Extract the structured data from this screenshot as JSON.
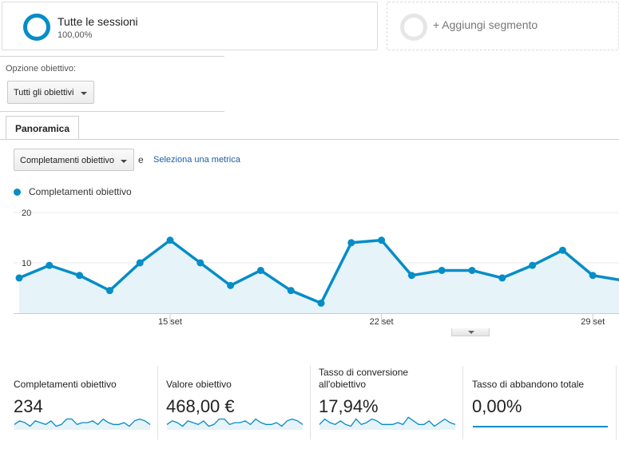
{
  "segments": {
    "active": {
      "title": "Tutte le sessioni",
      "subtitle": "100,00%"
    },
    "add_label": "+ Aggiungi segmento"
  },
  "goal_option": {
    "label": "Opzione obiettivo:",
    "selected": "Tutti gli obiettivi"
  },
  "tabs": [
    {
      "label": "Panoramica",
      "active": true
    }
  ],
  "metric_picker": {
    "selected": "Completamenti obiettivo",
    "conjunction": "e",
    "second_metric_link": "Seleziona una metrica"
  },
  "legend": {
    "series_name": "Completamenti obiettivo",
    "color": "#058dc7"
  },
  "chart_data": {
    "type": "area",
    "series": [
      {
        "name": "Completamenti obiettivo",
        "values": [
          7,
          9.5,
          7.5,
          4.5,
          10,
          14.5,
          10,
          5.5,
          8.5,
          4.5,
          2,
          14,
          14.5,
          7.5,
          8.5,
          8.5,
          7,
          9.5,
          12.5,
          7.5,
          6.5
        ]
      }
    ],
    "y_ticks": [
      "20",
      "10"
    ],
    "ylim": [
      0,
      20
    ],
    "x_tick_labels": [
      "15 set",
      "22 set",
      "29 set"
    ],
    "x_tick_index": [
      5,
      12,
      19
    ],
    "grid": true,
    "color": "#058dc7",
    "fill": "#e6f3f9"
  },
  "metrics": [
    {
      "label": "Completamenti obiettivo",
      "value": "234",
      "spark": [
        3,
        5,
        4,
        2,
        5,
        4,
        3,
        5,
        2,
        3,
        6,
        6,
        3,
        4,
        4,
        5,
        3,
        6,
        4,
        3,
        3,
        4,
        2,
        5,
        6,
        5,
        3
      ]
    },
    {
      "label": "Valore obiettivo",
      "value": "468,00 €",
      "spark": [
        3,
        5,
        4,
        2,
        5,
        4,
        3,
        5,
        2,
        3,
        6,
        6,
        3,
        4,
        4,
        5,
        3,
        6,
        4,
        3,
        3,
        4,
        2,
        5,
        6,
        5,
        3
      ]
    },
    {
      "label": "Tasso di conversione all'obiettivo",
      "value": "17,94%",
      "spark": [
        3,
        6,
        4,
        3,
        5,
        3,
        2,
        6,
        3,
        4,
        6,
        5,
        3,
        3,
        3,
        4,
        3,
        7,
        5,
        3,
        3,
        5,
        2,
        4,
        6,
        4,
        3
      ]
    },
    {
      "label": "Tasso di abbandono totale",
      "value": "0,00%",
      "spark": []
    }
  ]
}
